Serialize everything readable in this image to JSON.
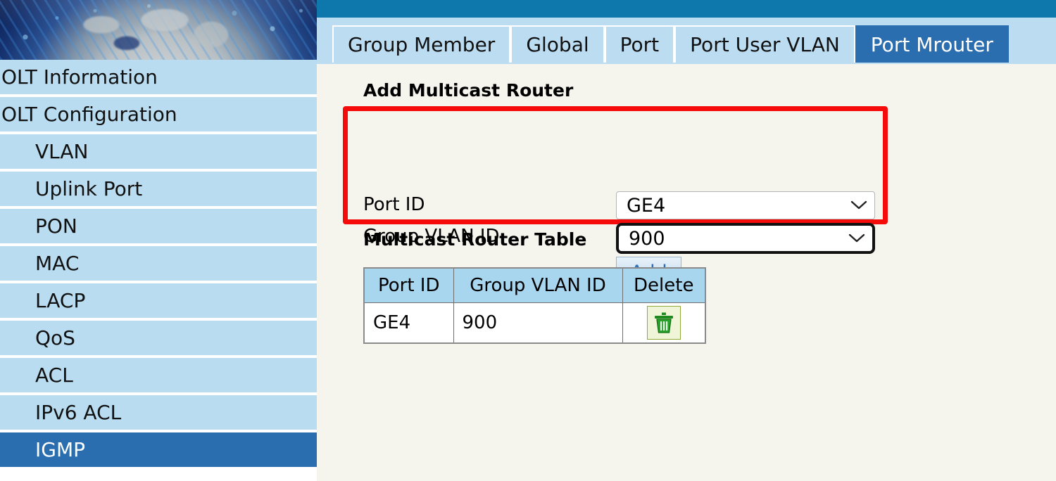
{
  "sidebar": {
    "banner_alt": "globe-network-banner",
    "items": [
      {
        "label": "OLT Information",
        "level": "top",
        "active": false,
        "name": "sidebar-item-olt-information"
      },
      {
        "label": "OLT Configuration",
        "level": "top",
        "active": false,
        "name": "sidebar-item-olt-configuration"
      },
      {
        "label": "VLAN",
        "level": "sub",
        "active": false,
        "name": "sidebar-item-vlan"
      },
      {
        "label": "Uplink Port",
        "level": "sub",
        "active": false,
        "name": "sidebar-item-uplink-port"
      },
      {
        "label": "PON",
        "level": "sub",
        "active": false,
        "name": "sidebar-item-pon"
      },
      {
        "label": "MAC",
        "level": "sub",
        "active": false,
        "name": "sidebar-item-mac"
      },
      {
        "label": "LACP",
        "level": "sub",
        "active": false,
        "name": "sidebar-item-lacp"
      },
      {
        "label": "QoS",
        "level": "sub",
        "active": false,
        "name": "sidebar-item-qos"
      },
      {
        "label": "ACL",
        "level": "sub",
        "active": false,
        "name": "sidebar-item-acl"
      },
      {
        "label": "IPv6 ACL",
        "level": "sub",
        "active": false,
        "name": "sidebar-item-ipv6-acl"
      },
      {
        "label": "IGMP",
        "level": "sub",
        "active": true,
        "name": "sidebar-item-igmp"
      }
    ]
  },
  "tabs": [
    {
      "label": "Group Member",
      "active": false,
      "name": "tab-group-member"
    },
    {
      "label": "Global",
      "active": false,
      "name": "tab-global"
    },
    {
      "label": "Port",
      "active": false,
      "name": "tab-port"
    },
    {
      "label": "Port User VLAN",
      "active": false,
      "name": "tab-port-user-vlan"
    },
    {
      "label": "Port Mrouter",
      "active": true,
      "name": "tab-port-mrouter"
    }
  ],
  "add_form": {
    "title": "Add Multicast Router",
    "port_id": {
      "label": "Port ID",
      "value": "GE4",
      "focused": false
    },
    "group_vlan_id": {
      "label": "Group VLAN ID",
      "value": "900",
      "focused": true
    },
    "add_button": "Add",
    "highlight_color": "#f60b0b"
  },
  "router_table": {
    "title": "Multicast Router Table",
    "columns": [
      "Port ID",
      "Group VLAN ID",
      "Delete"
    ],
    "rows": [
      {
        "port_id": "GE4",
        "group_vlan_id": "900",
        "delete_icon": "trash-icon"
      }
    ]
  },
  "icons": {
    "chevron_down": "chevron-down-icon",
    "trash": "trash-icon",
    "cursor": "mouse-cursor-arrow"
  },
  "colors": {
    "topbar": "#0e78ac",
    "tab_active": "#2a6eb0",
    "tab_inactive": "#bcdcf2",
    "sidebar_item": "#b9dcf0",
    "sidebar_active": "#2a6eb0",
    "content_bg": "#f5f5ee",
    "table_header": "#a9d6ef",
    "highlight_red": "#f60b0b",
    "cursor_fill": "#aaff00"
  }
}
